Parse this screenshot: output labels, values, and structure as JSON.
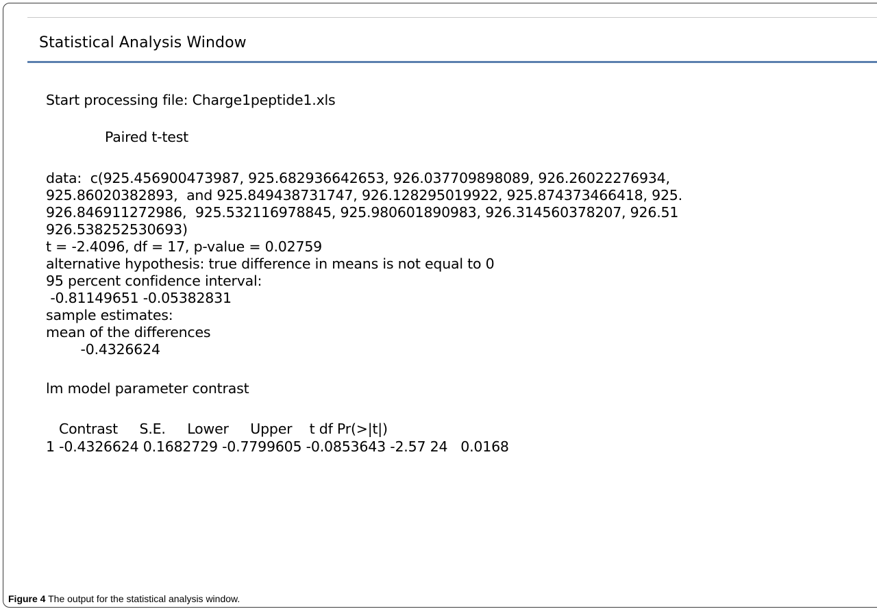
{
  "window": {
    "title": "Statistical Analysis Window"
  },
  "output": {
    "start_line": "Start processing file: Charge1peptide1.xls",
    "test_name": "Paired t-test",
    "data_line_1": "data:  c(925.456900473987, 925.682936642653, 926.037709898089, 926.26022276934,",
    "data_line_2": "925.86020382893,  and 925.849438731747, 926.128295019922, 925.874373466418, 925.",
    "data_line_3": "926.846911272986,  925.532116978845, 925.980601890983, 926.314560378207, 926.51",
    "data_line_4": "926.538252530693)",
    "stat_line": "t = -2.4096, df = 17, p-value = 0.02759",
    "alt_hypothesis": "alternative hypothesis: true difference in means is not equal to 0",
    "ci_label": "95 percent confidence interval:",
    "ci_values": " -0.81149651 -0.05382831",
    "estimates_label": "sample estimates:",
    "mean_label": "mean of the differences",
    "mean_value": "        -0.4326624",
    "lm_title": "lm model parameter contrast",
    "contrast_header": "   Contrast     S.E.     Lower     Upper    t df Pr(>|t|)",
    "contrast_row": "1 -0.4326624 0.1682729 -0.7799605 -0.0853643 -2.57 24   0.0168"
  },
  "caption": {
    "label": "Figure 4",
    "text": " The output for the statistical analysis window."
  }
}
